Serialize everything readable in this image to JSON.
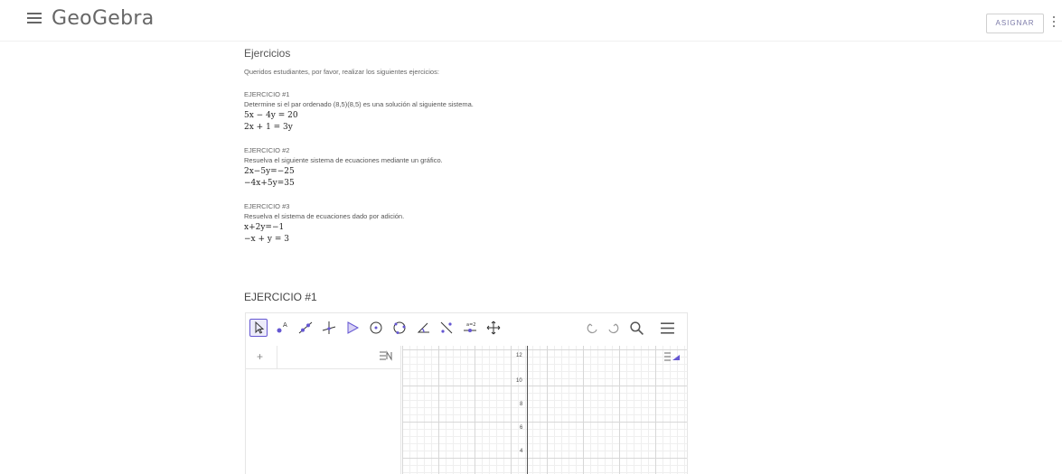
{
  "header": {
    "logo": "GeoGebra",
    "assign_label": "ASIGNAR"
  },
  "content": {
    "title": "Ejercicios",
    "intro": "Queridos estudiantes, por favor, realizar los siguientes ejercicios:",
    "exercises": [
      {
        "title": "EJERCICIO #1",
        "desc": "Determine si el par ordenado (8,5)(8,5) es una solución al siguiente sistema.",
        "eq1": "5x − 4y = 20",
        "eq2": "2x + 1 = 3y"
      },
      {
        "title": "EJERCICIO #2",
        "desc": "Resuelva el siguiente sistema de ecuaciones mediante un gráfico.",
        "eq1": "2x−5y=−25",
        "eq2": "−4x+5y=35"
      },
      {
        "title": "EJERCICIO #3",
        "desc": "Resuelva el sistema de ecuaciones dado por adición.",
        "eq1": "x+2y=−1",
        "eq2": "−x + y = 3"
      }
    ],
    "section_title": "EJERCICIO #1"
  },
  "applet": {
    "algebra_plus": "+",
    "y_ticks": [
      "12",
      "10",
      "8",
      "6",
      "4"
    ],
    "tools": [
      "move-tool-icon",
      "point-tool-icon",
      "line-tool-icon",
      "perpendicular-tool-icon",
      "polygon-tool-icon",
      "circle-tool-icon",
      "circle-three-points-tool-icon",
      "angle-tool-icon",
      "reflect-tool-icon",
      "slider-tool-icon",
      "move-graphics-tool-icon"
    ],
    "accent_color": "#6557d2"
  }
}
